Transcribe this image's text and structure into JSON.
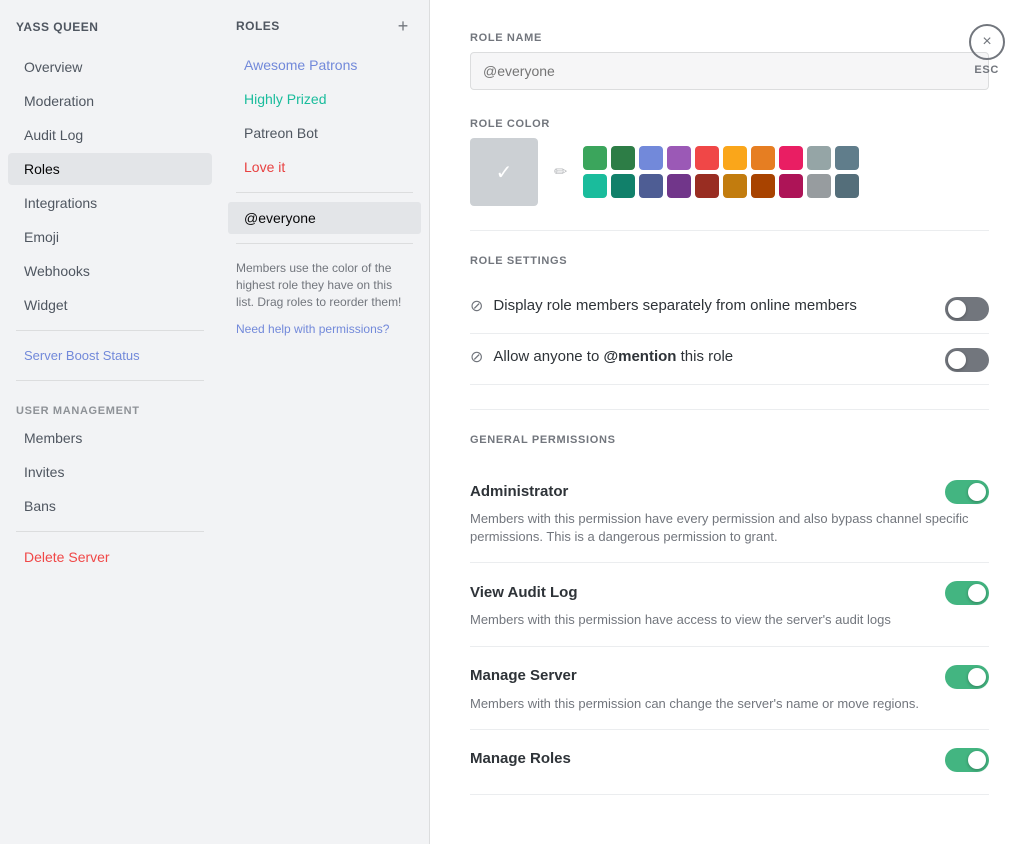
{
  "server": {
    "name": "YASS QUEEN"
  },
  "sidebar": {
    "items": [
      {
        "id": "overview",
        "label": "Overview",
        "active": false
      },
      {
        "id": "moderation",
        "label": "Moderation",
        "active": false
      },
      {
        "id": "audit-log",
        "label": "Audit Log",
        "active": false
      },
      {
        "id": "roles",
        "label": "Roles",
        "active": true
      },
      {
        "id": "integrations",
        "label": "Integrations",
        "active": false
      },
      {
        "id": "emoji",
        "label": "Emoji",
        "active": false
      },
      {
        "id": "webhooks",
        "label": "Webhooks",
        "active": false
      },
      {
        "id": "widget",
        "label": "Widget",
        "active": false
      }
    ],
    "boost_label": "Server Boost Status",
    "user_management_label": "USER MANAGEMENT",
    "user_management_items": [
      {
        "id": "members",
        "label": "Members"
      },
      {
        "id": "invites",
        "label": "Invites"
      },
      {
        "id": "bans",
        "label": "Bans"
      }
    ],
    "delete_server_label": "Delete Server"
  },
  "roles_panel": {
    "title": "ROLES",
    "add_button_symbol": "+",
    "roles": [
      {
        "id": "awesome-patrons",
        "label": "Awesome Patrons",
        "color": "blue"
      },
      {
        "id": "highly-prized",
        "label": "Highly Prized",
        "color": "teal"
      },
      {
        "id": "patreon-bot",
        "label": "Patreon Bot",
        "color": "default"
      },
      {
        "id": "love-it",
        "label": "Love it",
        "color": "red"
      },
      {
        "id": "everyone",
        "label": "@everyone",
        "selected": true
      }
    ],
    "help_text": "Members use the color of the highest role they have on this list. Drag roles to reorder them!",
    "help_link": "Need help with permissions?"
  },
  "main": {
    "role_name_label": "ROLE NAME",
    "role_name_placeholder": "@everyone",
    "role_color_label": "ROLE COLOR",
    "role_settings_label": "ROLE SETTINGS",
    "settings": [
      {
        "id": "display-separately",
        "title": "Display role members separately from online members",
        "enabled": false
      },
      {
        "id": "allow-mention",
        "title_prefix": "Allow anyone to ",
        "title_highlight": "@mention",
        "title_suffix": " this role",
        "enabled": false
      }
    ],
    "general_permissions_label": "GENERAL PERMISSIONS",
    "permissions": [
      {
        "id": "administrator",
        "name": "Administrator",
        "description": "Members with this permission have every permission and also bypass channel specific permissions. This is a dangerous permission to grant.",
        "enabled": true
      },
      {
        "id": "view-audit-log",
        "name": "View Audit Log",
        "description": "Members with this permission have access to view the server's audit logs",
        "enabled": true
      },
      {
        "id": "manage-server",
        "name": "Manage Server",
        "description": "Members with this permission can change the server's name or move regions.",
        "enabled": true
      },
      {
        "id": "manage-roles",
        "name": "Manage Roles",
        "description": "",
        "enabled": true
      }
    ]
  },
  "colors": {
    "swatches_row1": [
      "#3ba55c",
      "#2d7d46",
      "#7289da",
      "#9b59b6",
      "#f04747",
      "#faa61a",
      "#e67e22",
      "#e91e63",
      "#95a5a6",
      "#607d8b"
    ],
    "swatches_row2": [
      "#1abc9c",
      "#11806a",
      "#4e5d94",
      "#71368a",
      "#992d22",
      "#c27c0e",
      "#a84300",
      "#ad1457",
      "#979c9f",
      "#546e7a"
    ]
  },
  "close_button_label": "×",
  "esc_label": "ESC"
}
